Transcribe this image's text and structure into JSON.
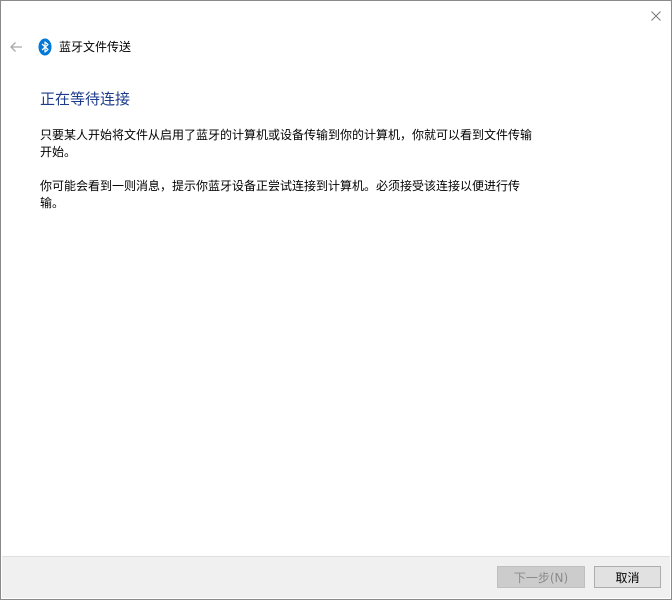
{
  "window": {
    "close_icon": "close-icon",
    "back_icon": "back-arrow-icon"
  },
  "header": {
    "icon": "bluetooth-icon",
    "title": "蓝牙文件传送"
  },
  "main": {
    "heading": "正在等待连接",
    "paragraph1": "只要某人开始将文件从启用了蓝牙的计算机或设备传输到你的计算机，你就可以看到文件传输开始。",
    "paragraph2": "你可能会看到一则消息，提示你蓝牙设备正尝试连接到计算机。必须接受该连接以便进行传输。"
  },
  "footer": {
    "next_label": "下一步(N)",
    "next_enabled": false,
    "cancel_label": "取消"
  },
  "colors": {
    "heading": "#1e3c8c",
    "bluetooth_badge": "#0078d7",
    "footer_bg": "#f0f0f0"
  }
}
